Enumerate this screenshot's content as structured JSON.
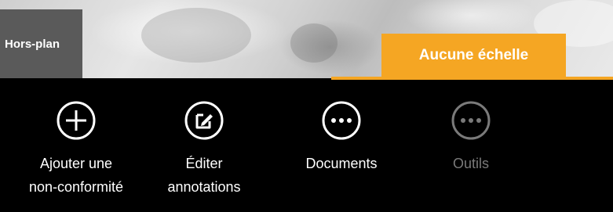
{
  "header": {
    "offplan_tab_label": "Hors-plan",
    "scale_tab_label": "Aucune échelle"
  },
  "colors": {
    "accent": "#f5a623",
    "toolbar_bg": "#000000",
    "offplan_tab_bg": "#5a5a5a",
    "enabled_text": "#ffffff",
    "disabled_text": "#7a7a7a"
  },
  "toolbar": {
    "items": [
      {
        "icon": "plus-circle-icon",
        "label_line1": "Ajouter une",
        "label_line2": "non-conformité",
        "enabled": true
      },
      {
        "icon": "edit-square-icon",
        "label_line1": "Éditer",
        "label_line2": "annotations",
        "enabled": true
      },
      {
        "icon": "more-circle-icon",
        "label_line1": "Documents",
        "label_line2": "",
        "enabled": true
      },
      {
        "icon": "more-circle-icon",
        "label_line1": "Outils",
        "label_line2": "",
        "enabled": false
      }
    ]
  }
}
